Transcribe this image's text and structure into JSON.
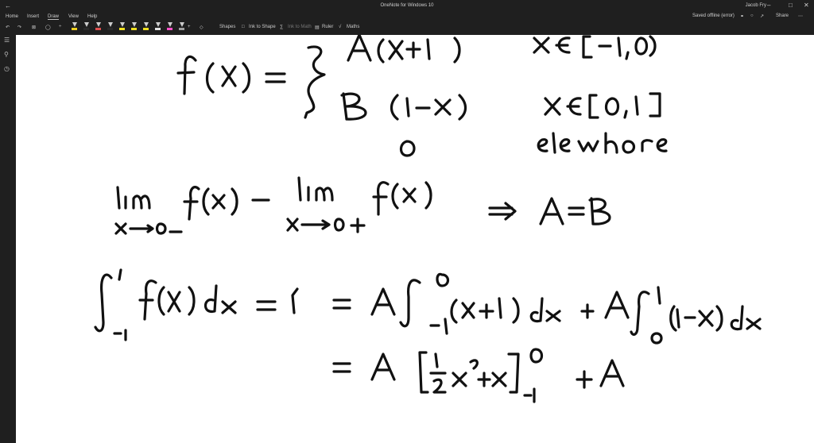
{
  "window": {
    "title": "OneNote for Windows 10",
    "user": "Jacob Fry"
  },
  "menu": {
    "items": [
      "Home",
      "Insert",
      "Draw",
      "View",
      "Help"
    ],
    "active": "Draw"
  },
  "toolbar": {
    "shapes_label": "Shapes",
    "ink_to_shape_label": "Ink to Shape",
    "ink_to_math_label": "Ink to Math",
    "ruler_label": "Ruler",
    "maths_label": "Maths",
    "pen_colors": [
      "#f0d020",
      "#2a2a2a",
      "#e05050",
      "#2a2a2a",
      "#f0e020",
      "#f0e020",
      "#f0e020",
      "#e0e0e0",
      "#ff50c8",
      "#a0a0a0"
    ]
  },
  "status": {
    "sync": "Saved offline (error)",
    "share_label": "Share"
  },
  "math": [
    "f(x) = { A(x+1)  x ∈ [-1,0)",
    "B (1-x)  x ∈ [0,1]",
    "0  elsewhere",
    "lim x→0- f(x) = lim x→0+ f(x)  ⇒ A = B",
    "∫ from -1 to 1 f(x) dx = 1 = A ∫ from -1 to 0 (x+1) dx + A ∫ from 0 to 1 (1-x) dx",
    "= A [ ½x² + x ] from -1 to 0 + A"
  ]
}
